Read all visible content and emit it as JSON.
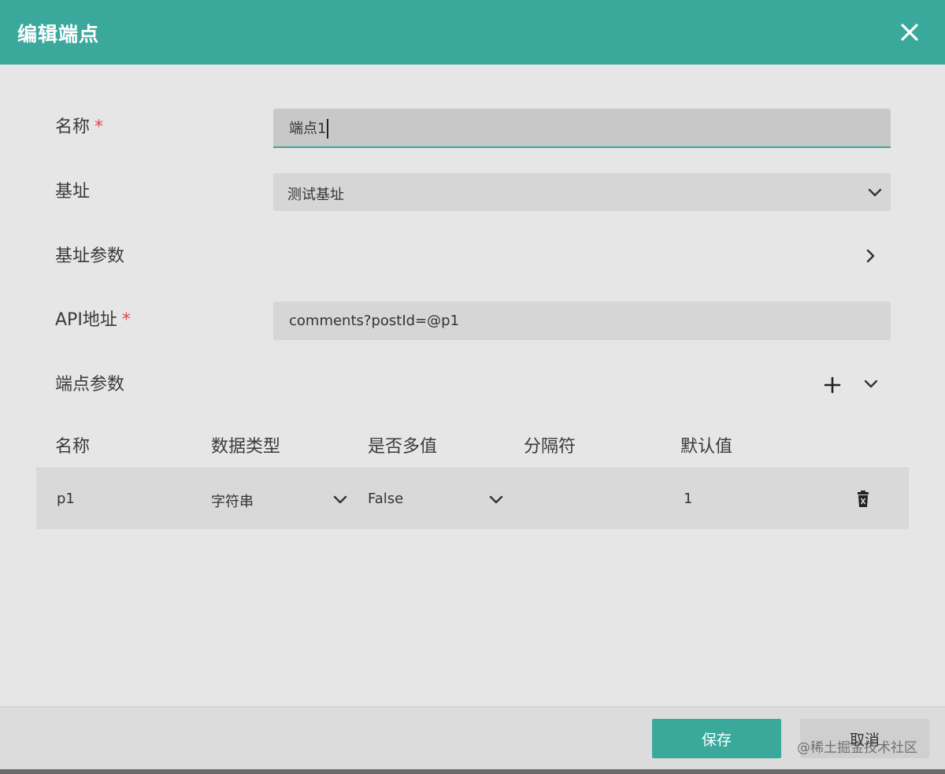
{
  "dialog": {
    "title": "编辑端点"
  },
  "form": {
    "name_label": "名称",
    "name_value": "端点1",
    "required_mark": "*",
    "base_label": "基址",
    "base_value": "测试基址",
    "base_params_label": "基址参数",
    "api_label": "API地址",
    "api_value": "comments?postId=@p1",
    "endpoint_params_label": "端点参数"
  },
  "table": {
    "headers": [
      "名称",
      "数据类型",
      "是否多值",
      "分隔符",
      "默认值"
    ],
    "rows": [
      {
        "name": "p1",
        "type": "字符串",
        "multi": "False",
        "separator": "",
        "default": "1"
      }
    ]
  },
  "footer": {
    "save_label": "保存",
    "cancel_label": "取消",
    "watermark": "@稀土掘金技术社区"
  },
  "colors": {
    "accent": "#3aa99c",
    "required": "#e0474c",
    "background": "#e6e6e6"
  },
  "icons": {
    "close": "close-icon",
    "dropdown": "chevron-down-icon",
    "expand": "chevron-right-icon",
    "add": "plus-icon",
    "collapse": "chevron-down-icon",
    "delete": "trash-icon"
  }
}
